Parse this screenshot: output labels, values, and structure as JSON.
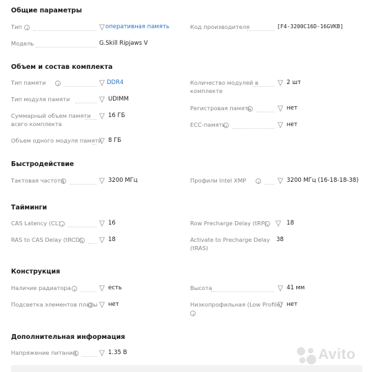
{
  "sections": {
    "general": {
      "title": "Общие параметры",
      "type_label": "Тип",
      "type_value": "оперативная память",
      "model_label": "Модель",
      "model_value": "G.Skill Ripjaws V",
      "mfr_code_label": "Код производителя",
      "mfr_code_value": "[F4-3200C16D-16GVKB]"
    },
    "kit": {
      "title": "Объем и состав комплекта",
      "mem_type_label": "Тип памяти",
      "mem_type_value": "DDR4",
      "module_type_label": "Тип модуля памяти",
      "module_type_value": "UDIMM",
      "total_label_1": "Суммарный объем памяти",
      "total_label_2": "всего комплекта",
      "total_value": "16 ГБ",
      "single_label": "Объем одного модуля памяти",
      "single_value": "8 ГБ",
      "modules_label_1": "Количество модулей в",
      "modules_label_2": "комплекте",
      "modules_value": "2 шт",
      "registered_label": "Регистровая память",
      "registered_value": "нет",
      "ecc_label": "ECC-память",
      "ecc_value": "нет"
    },
    "perf": {
      "title": "Быстродействие",
      "freq_label": "Тактовая частота",
      "freq_value": "3200 МГц",
      "xmp_label": "Профили Intel XMP",
      "xmp_value": "3200 МГц (16-18-18-38)"
    },
    "timings": {
      "title": "Тайминги",
      "cl_label": "CAS Latency (CL)",
      "cl_value": "16",
      "trcd_label": "RAS to CAS Delay (tRCD)",
      "trcd_value": "18",
      "trp_label": "Row Precharge Delay (tRP)",
      "trp_value": "18",
      "tras_label_1": "Activate to Precharge Delay",
      "tras_label_2": "(tRAS)",
      "tras_value": "38"
    },
    "design": {
      "title": "Конструкция",
      "heatsink_label": "Наличие радиатора",
      "heatsink_value": "есть",
      "backlight_label": "Подсветка элементов платы",
      "backlight_value": "нет",
      "height_label": "Высота",
      "height_value": "41 мм",
      "lowprofile_label": "Низкопрофильная (Low Profile)",
      "lowprofile_value": "нет"
    },
    "extra": {
      "title": "Дополнительная информация",
      "voltage_label": "Напряжение питания",
      "voltage_value": "1.35 В"
    }
  },
  "watermark": {
    "text": "Avito"
  },
  "colors": {
    "label": "#858585",
    "value": "#1f1f1f",
    "link": "#2a74c7",
    "icon": "#a9a9a9"
  }
}
